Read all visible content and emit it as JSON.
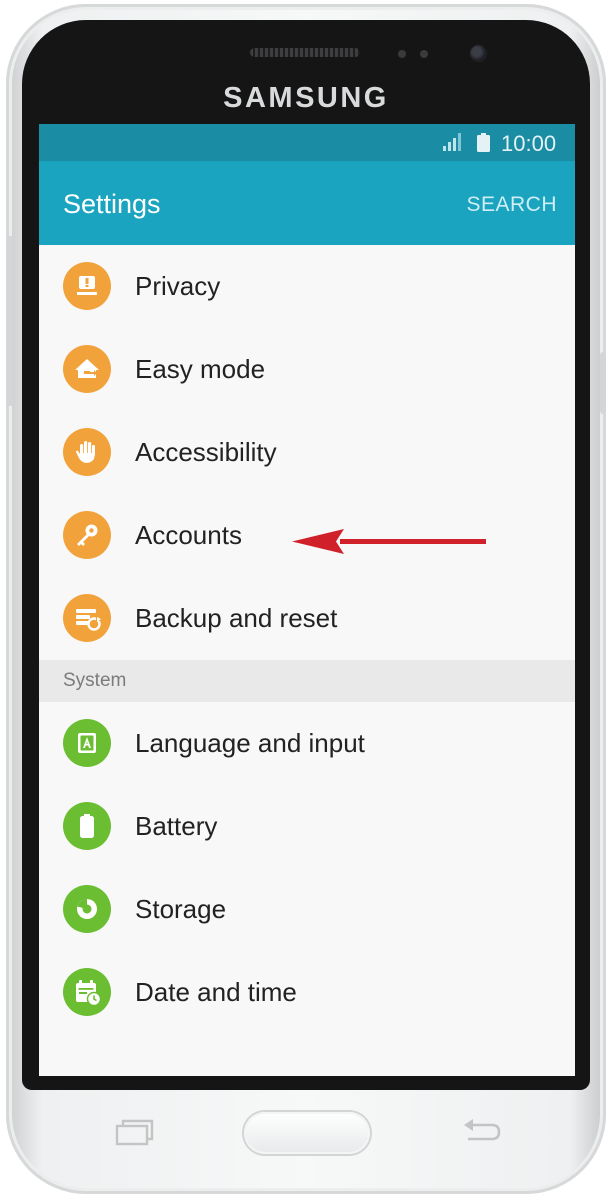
{
  "device": {
    "brand": "SAMSUNG"
  },
  "status_bar": {
    "time": "10:00",
    "signal_icon": "signal-bars-icon",
    "battery_icon": "battery-icon"
  },
  "app_bar": {
    "title": "Settings",
    "search_label": "SEARCH",
    "color": "#1ba4bf",
    "status_color": "#1a8da4"
  },
  "personal_items": [
    {
      "label": "Privacy",
      "icon": "privacy-icon",
      "color": "#f2a23b"
    },
    {
      "label": "Easy mode",
      "icon": "easy-mode-icon",
      "color": "#f2a23b"
    },
    {
      "label": "Accessibility",
      "icon": "accessibility-hand-icon",
      "color": "#f2a23b"
    },
    {
      "label": "Accounts",
      "icon": "key-icon",
      "color": "#f2a23b"
    },
    {
      "label": "Backup and reset",
      "icon": "backup-reset-icon",
      "color": "#f2a23b"
    }
  ],
  "system_section": {
    "header": "System",
    "items": [
      {
        "label": "Language and input",
        "icon": "language-icon",
        "color": "#6bbd32"
      },
      {
        "label": "Battery",
        "icon": "battery-setting-icon",
        "color": "#6bbd32"
      },
      {
        "label": "Storage",
        "icon": "storage-icon",
        "color": "#6bbd32"
      },
      {
        "label": "Date and time",
        "icon": "calendar-clock-icon",
        "color": "#6bbd32"
      }
    ]
  },
  "annotation": {
    "arrow_color": "#d0202a",
    "target": "Accounts"
  }
}
